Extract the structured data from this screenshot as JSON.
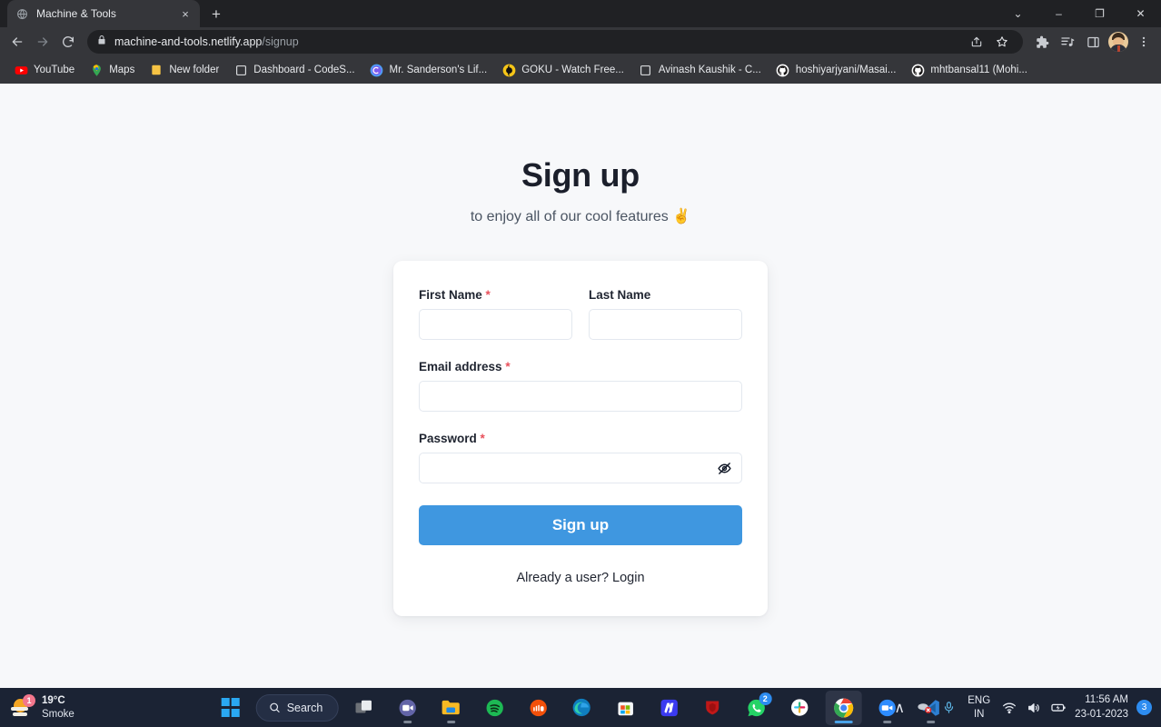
{
  "browser": {
    "tab": {
      "title": "Machine & Tools",
      "favicon": "globe-icon",
      "close": "×"
    },
    "new_tab_label": "+",
    "window_controls": {
      "list": "⌄",
      "minimize": "–",
      "maximize": "❐",
      "close": "✕"
    },
    "omnibox": {
      "domain": "machine-and-tools.netlify.app",
      "path": "/signup",
      "lock": "lock-icon"
    },
    "bookmarks": [
      {
        "label": "YouTube",
        "icon": "youtube-icon"
      },
      {
        "label": "Maps",
        "icon": "google-maps-icon"
      },
      {
        "label": "New folder",
        "icon": "folder-icon"
      },
      {
        "label": "Dashboard - CodeS...",
        "icon": "page-icon"
      },
      {
        "label": "Mr. Sanderson's Lif...",
        "icon": "circle-c-icon"
      },
      {
        "label": "GOKU - Watch Free...",
        "icon": "goku-icon"
      },
      {
        "label": "Avinash Kaushik - C...",
        "icon": "page-icon"
      },
      {
        "label": "hoshiyarjyani/Masai...",
        "icon": "github-icon"
      },
      {
        "label": "mhtbansal11 (Mohi...",
        "icon": "github-icon"
      }
    ]
  },
  "page": {
    "heading": "Sign up",
    "subheading": "to enjoy all of our cool features ✌️",
    "form": {
      "first_name": {
        "label": "First Name",
        "required": "*",
        "value": "",
        "placeholder": ""
      },
      "last_name": {
        "label": "Last Name",
        "required": "",
        "value": "",
        "placeholder": ""
      },
      "email": {
        "label": "Email address",
        "required": "*",
        "value": "",
        "placeholder": ""
      },
      "password": {
        "label": "Password",
        "required": "*",
        "value": "",
        "placeholder": "",
        "toggle_icon": "eye-off-icon"
      },
      "submit_label": "Sign up",
      "footer_text": "Already a user?",
      "footer_link": "Login"
    },
    "colors": {
      "accent": "#3f97e0",
      "required": "#e8505b",
      "background": "#f7f8fa",
      "card": "#ffffff"
    }
  },
  "taskbar": {
    "weather": {
      "temperature": "19°C",
      "condition": "Smoke",
      "badge": "1",
      "icon": "sun-haze-icon"
    },
    "start_label": "start-button",
    "search_label": "Search",
    "apps": [
      {
        "name": "task-view",
        "icon": "task-view-icon",
        "badge": "",
        "active": false,
        "running": false
      },
      {
        "name": "teams",
        "icon": "teams-icon",
        "badge": "",
        "active": false,
        "running": true
      },
      {
        "name": "file-explorer",
        "icon": "folder-icon",
        "badge": "",
        "active": false,
        "running": true
      },
      {
        "name": "spotify",
        "icon": "spotify-icon",
        "badge": "",
        "active": false,
        "running": false
      },
      {
        "name": "soundcloud",
        "icon": "soundcloud-icon",
        "badge": "",
        "active": false,
        "running": false
      },
      {
        "name": "edge",
        "icon": "edge-icon",
        "badge": "",
        "active": false,
        "running": false
      },
      {
        "name": "microsoft-store",
        "icon": "store-icon",
        "badge": "",
        "active": false,
        "running": false
      },
      {
        "name": "masai-app",
        "icon": "m-icon",
        "badge": "",
        "active": false,
        "running": false
      },
      {
        "name": "mcafee",
        "icon": "mcafee-icon",
        "badge": "",
        "active": false,
        "running": false
      },
      {
        "name": "whatsapp",
        "icon": "whatsapp-icon",
        "badge": "2",
        "active": false,
        "running": false
      },
      {
        "name": "slack",
        "icon": "slack-icon",
        "badge": "",
        "active": false,
        "running": false
      },
      {
        "name": "chrome",
        "icon": "chrome-icon",
        "badge": "",
        "active": true,
        "running": true
      },
      {
        "name": "zoom",
        "icon": "zoom-icon",
        "badge": "",
        "active": false,
        "running": true
      },
      {
        "name": "vs-code",
        "icon": "vscode-icon",
        "badge": "",
        "active": false,
        "running": true
      }
    ],
    "tray": {
      "chevron": "∧",
      "language_line1": "ENG",
      "language_line2": "IN",
      "time": "11:56 AM",
      "date": "23-01-2023",
      "notification_count": "3"
    }
  }
}
